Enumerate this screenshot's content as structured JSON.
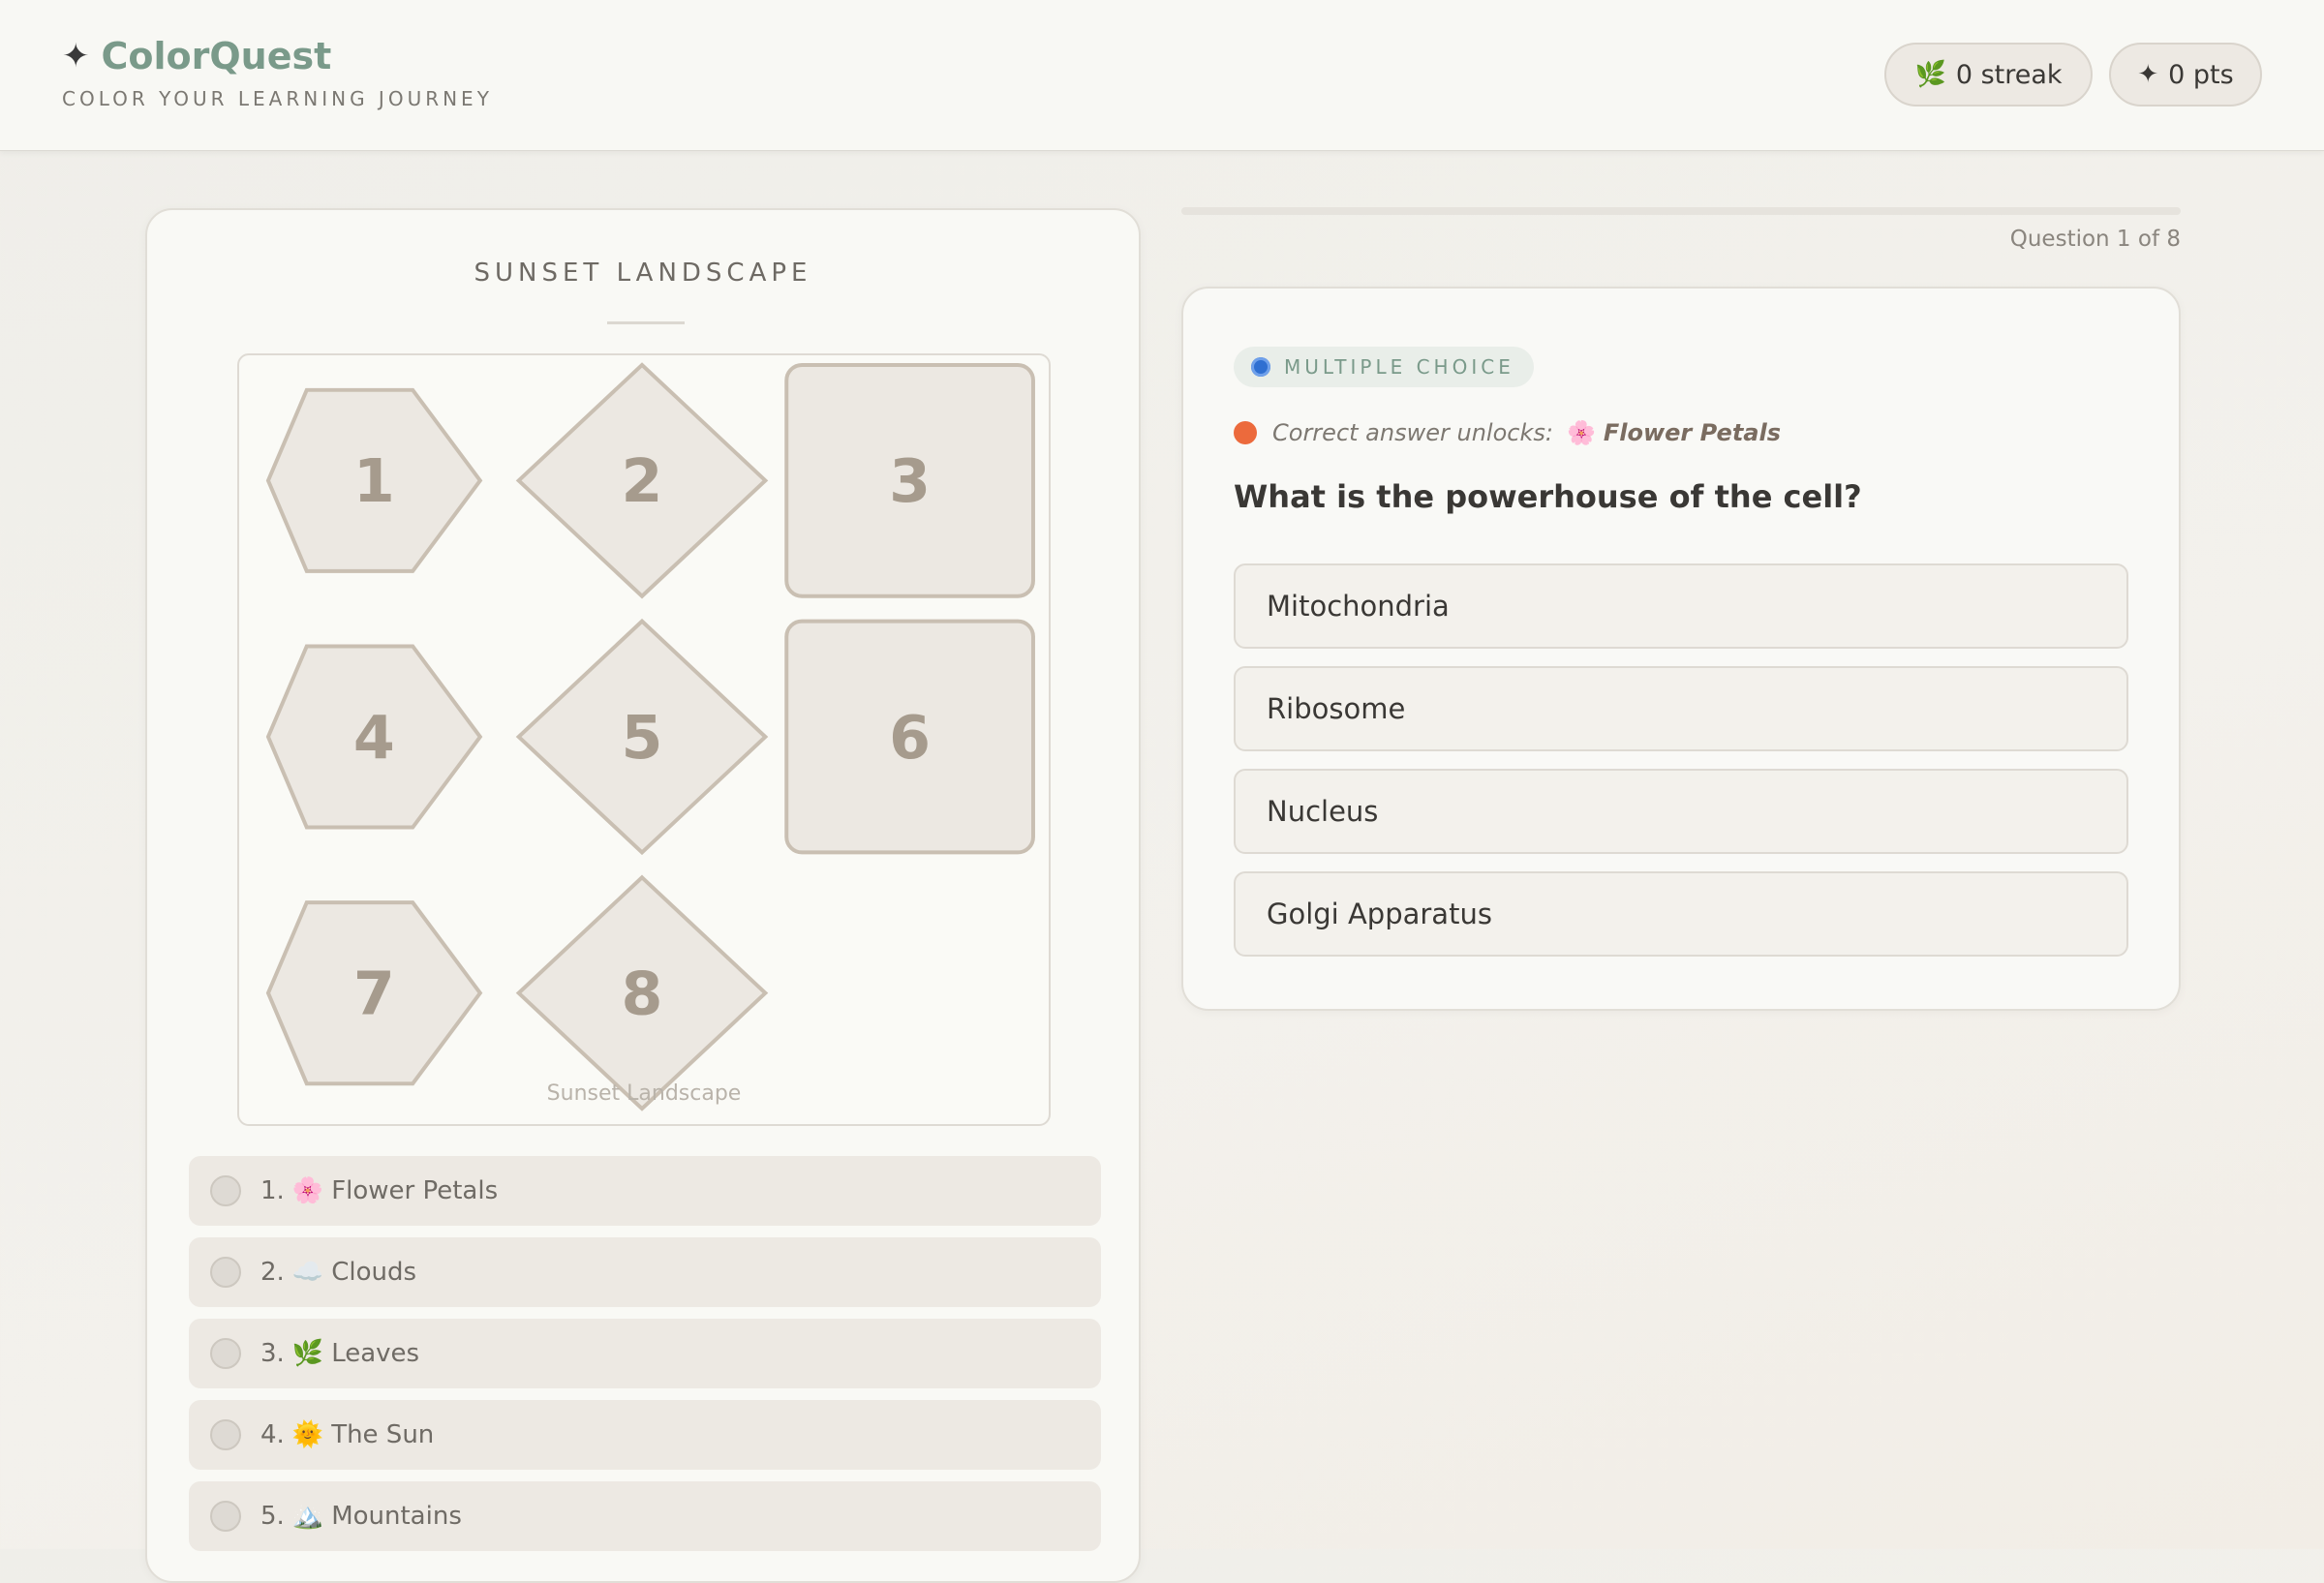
{
  "app": {
    "title": "ColorQuest",
    "tagline": "COLOR YOUR LEARNING JOURNEY",
    "star_glyph": "✦",
    "brand_color": "#7a9a8a"
  },
  "stats": {
    "streak_icon": "🌿",
    "streak_label": "0 streak",
    "points_icon": "✦",
    "points_label": "0 pts"
  },
  "picture": {
    "title": "SUNSET LANDSCAPE",
    "caption": "Sunset Landscape",
    "regions": [
      {
        "number": "1",
        "shape": "hexagon"
      },
      {
        "number": "2",
        "shape": "diamond"
      },
      {
        "number": "3",
        "shape": "square"
      },
      {
        "number": "4",
        "shape": "hexagon"
      },
      {
        "number": "5",
        "shape": "diamond"
      },
      {
        "number": "6",
        "shape": "square"
      },
      {
        "number": "7",
        "shape": "hexagon"
      },
      {
        "number": "8",
        "shape": "diamond"
      }
    ],
    "legend": [
      {
        "num": "1.",
        "emoji": "🌸",
        "label": "Flower Petals"
      },
      {
        "num": "2.",
        "emoji": "☁️",
        "label": "Clouds"
      },
      {
        "num": "3.",
        "emoji": "🌿",
        "label": "Leaves"
      },
      {
        "num": "4.",
        "emoji": "🌞",
        "label": "The Sun"
      },
      {
        "num": "5.",
        "emoji": "🏔️",
        "label": "Mountains"
      }
    ]
  },
  "quiz": {
    "progress": 0,
    "counter": "Question 1 of 8",
    "badge": "MULTIPLE CHOICE",
    "unlock_label": "Correct answer unlocks:",
    "unlock_emoji": "🌸",
    "unlock_target": "Flower Petals",
    "question": "What is the powerhouse of the cell?",
    "answers": [
      "Mitochondria",
      "Ribosome",
      "Nucleus",
      "Golgi Apparatus"
    ],
    "accent_blue": "#2f6fd1",
    "accent_orange": "#ec6a3c"
  }
}
